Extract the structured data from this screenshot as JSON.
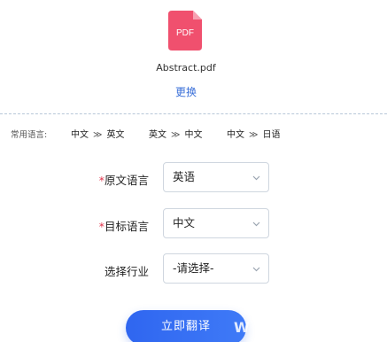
{
  "file": {
    "icon_label": "PDF",
    "name": "Abstract.pdf",
    "change_label": "更换",
    "icon_color": "#f0506e"
  },
  "common_languages": {
    "label": "常用语言:",
    "pairs": [
      {
        "from": "中文",
        "arrow": "≫",
        "to": "英文"
      },
      {
        "from": "英文",
        "arrow": "≫",
        "to": "中文"
      },
      {
        "from": "中文",
        "arrow": "≫",
        "to": "日语"
      }
    ]
  },
  "form": {
    "source": {
      "required_mark": "*",
      "label": "原文语言",
      "value": "英语"
    },
    "target": {
      "required_mark": "*",
      "label": "目标语言",
      "value": "中文"
    },
    "industry": {
      "label": "选择行业",
      "value": "-请选择-"
    }
  },
  "actions": {
    "translate_label": "立即翻译",
    "accent": "#2f66f0"
  },
  "watermark": {
    "text": "W"
  }
}
